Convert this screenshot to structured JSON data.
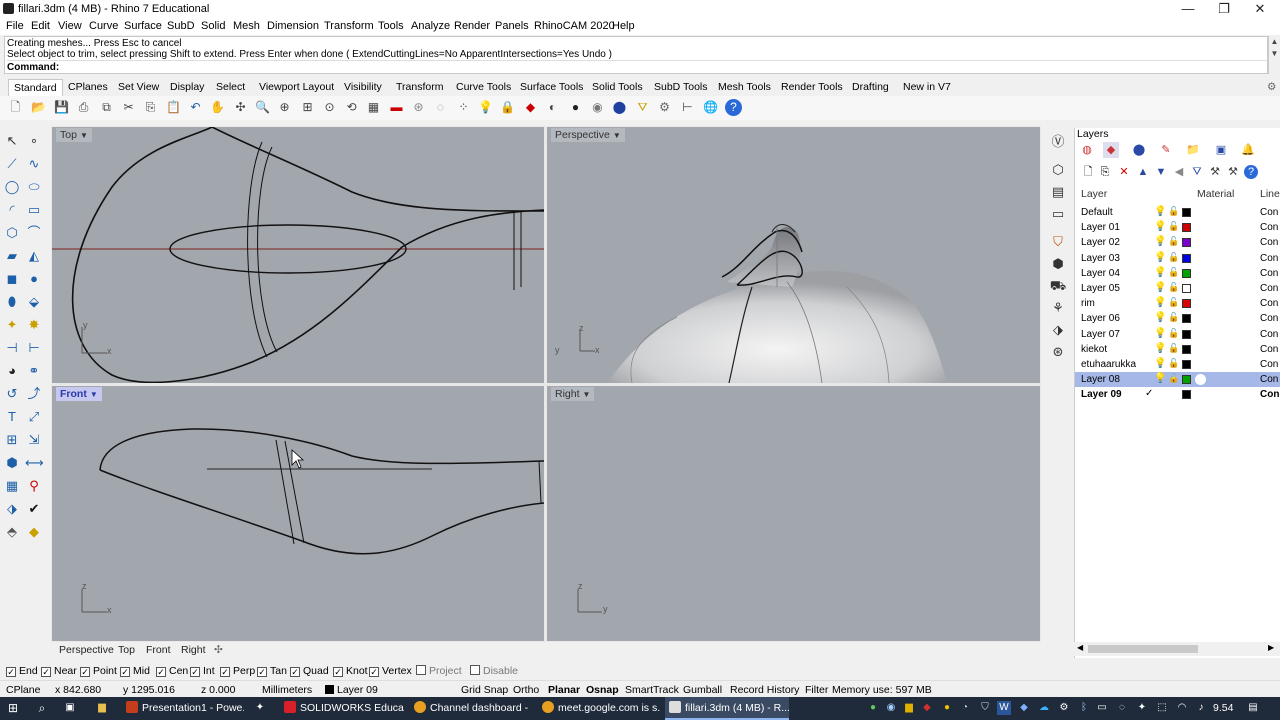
{
  "window": {
    "title": "fillari.3dm (4 MB) - Rhino 7 Educational",
    "minimize": "—",
    "restore": "❐",
    "close": "✕"
  },
  "menu": [
    "File",
    "Edit",
    "View",
    "Curve",
    "Surface",
    "SubD",
    "Solid",
    "Mesh",
    "Dimension",
    "Transform",
    "Tools",
    "Analyze",
    "Render",
    "Panels",
    "RhinoCAM 2020",
    "Help"
  ],
  "command": {
    "line1": "Creating meshes... Press Esc to cancel",
    "line2": "Select object to trim, select pressing Shift to extend. Press Enter when done ( ExtendCuttingLines=No  ApparentIntersections=Yes  Undo )",
    "prompt": "Command:"
  },
  "toolbar_tabs": [
    "Standard",
    "CPlanes",
    "Set View",
    "Display",
    "Select",
    "Viewport Layout",
    "Visibility",
    "Transform",
    "Curve Tools",
    "Surface Tools",
    "Solid Tools",
    "SubD Tools",
    "Mesh Tools",
    "Render Tools",
    "Drafting",
    "New in V7"
  ],
  "viewports": {
    "top": {
      "label": "Top",
      "axis_y": "y",
      "axis_x": "x"
    },
    "perspective": {
      "label": "Perspective",
      "axis_z": "z",
      "axis_y": "y",
      "axis_x": "x"
    },
    "front": {
      "label": "Front",
      "axis_z": "z",
      "axis_x": "x"
    },
    "right": {
      "label": "Right",
      "axis_z": "z",
      "axis_y": "y"
    }
  },
  "viewport_tabs": [
    "Perspective",
    "Top",
    "Front",
    "Right"
  ],
  "viewport_tab_add": "✣",
  "layers_panel": {
    "title": "Layers",
    "col_layer": "Layer",
    "col_material": "Material",
    "col_linetype": "Line",
    "rows": [
      {
        "name": "Default",
        "color": "#000000",
        "linetype": "Con"
      },
      {
        "name": "Layer 01",
        "color": "#cc0000",
        "linetype": "Con"
      },
      {
        "name": "Layer 02",
        "color": "#7a00cc",
        "linetype": "Con"
      },
      {
        "name": "Layer 03",
        "color": "#0000dd",
        "linetype": "Con"
      },
      {
        "name": "Layer 04",
        "color": "#00a000",
        "linetype": "Con"
      },
      {
        "name": "Layer 05",
        "color": "#ffffff",
        "linetype": "Con"
      },
      {
        "name": "rim",
        "color": "#dd0000",
        "linetype": "Con"
      },
      {
        "name": "Layer 06",
        "color": "#000000",
        "linetype": "Con"
      },
      {
        "name": "Layer 07",
        "color": "#000000",
        "linetype": "Con"
      },
      {
        "name": "kiekot",
        "color": "#000000",
        "linetype": "Con"
      },
      {
        "name": "etuhaarukka",
        "color": "#000000",
        "linetype": "Con"
      },
      {
        "name": "Layer 08",
        "color": "#00a000",
        "linetype": "Con"
      },
      {
        "name": "Layer 09",
        "color": "#000000",
        "linetype": "Con",
        "current": "✓"
      }
    ]
  },
  "osnap": [
    {
      "label": "End",
      "checked": "✓"
    },
    {
      "label": "Near",
      "checked": "✓"
    },
    {
      "label": "Point",
      "checked": "✓"
    },
    {
      "label": "Mid",
      "checked": "✓"
    },
    {
      "label": "Cen",
      "checked": "✓"
    },
    {
      "label": "Int",
      "checked": "✓"
    },
    {
      "label": "Perp",
      "checked": "✓"
    },
    {
      "label": "Tan",
      "checked": "✓"
    },
    {
      "label": "Quad",
      "checked": "✓"
    },
    {
      "label": "Knot",
      "checked": "✓"
    },
    {
      "label": "Vertex",
      "checked": "✓"
    },
    {
      "label": "Project",
      "checked": ""
    },
    {
      "label": "Disable",
      "checked": ""
    }
  ],
  "status": {
    "cplane": "CPlane",
    "x": "x 842.680",
    "y": "y 1295.016",
    "z": "z 0.000",
    "units": "Millimeters",
    "layer": "Layer 09",
    "grid_snap": "Grid Snap",
    "ortho": "Ortho",
    "planar": "Planar",
    "osnap": "Osnap",
    "smarttrack": "SmartTrack",
    "gumball": "Gumball",
    "record_history": "Record History",
    "filter": "Filter",
    "memory": "Memory use: 597 MB"
  },
  "taskbar": {
    "items": [
      {
        "label": "Presentation1 - Powe...",
        "color": "#c43e1c"
      },
      {
        "label": "SOLIDWORKS Educati...",
        "color": "#d8202a"
      },
      {
        "label": "Channel dashboard - ...",
        "color": "#e8a020"
      },
      {
        "label": "meet.google.com is s...",
        "color": "#e8a020"
      },
      {
        "label": "fillari.3dm (4 MB) - R...",
        "color": "#dddddd"
      }
    ],
    "time": "9.54"
  }
}
